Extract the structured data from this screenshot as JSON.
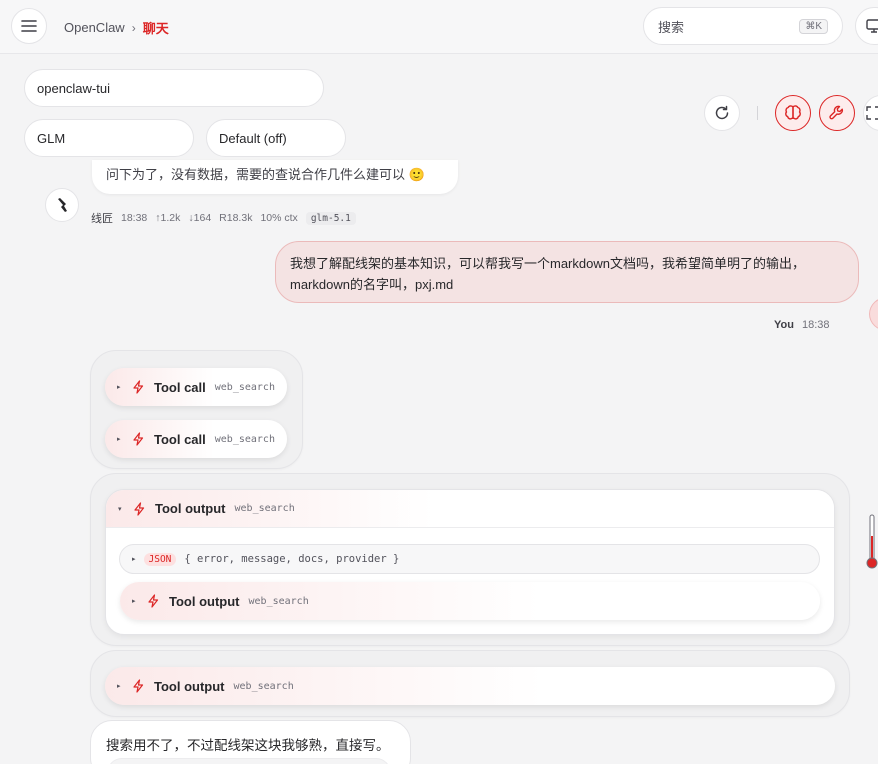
{
  "header": {
    "app_name": "OpenClaw",
    "separator": "›",
    "current_page": "聊天",
    "search_placeholder": "搜索",
    "search_shortcut": "⌘K"
  },
  "controls": {
    "session": "openclaw-tui",
    "model": "GLM",
    "thinking": "Default (off)"
  },
  "toolbar_icons": [
    "refresh-icon",
    "brain-icon",
    "wrench-icon",
    "expand-icon"
  ],
  "messages": {
    "previous_assistant_text": "问下为了，没有数据，需要的查说合作几件么建可以 🙂",
    "assistant_meta": {
      "sender": "线匠",
      "time": "18:38",
      "tokens_in": "↑1.2k",
      "tokens_out": "↓164",
      "cache": "R18.3k",
      "context": "10% ctx",
      "model": "glm-5.1"
    },
    "user_message": "我想了解配线架的基本知识，可以帮我写一个markdown文档吗，我希望简单明了的输出，markdown的名字叫，pxj.md",
    "user_meta": {
      "sender": "You",
      "time": "18:38"
    },
    "tool_calls": [
      {
        "label": "Tool call",
        "name": "web_search"
      },
      {
        "label": "Tool call",
        "name": "web_search"
      }
    ],
    "tool_output_expanded": {
      "label": "Tool output",
      "name": "web_search",
      "json_badge": "JSON",
      "json_summary": "{ error, message, docs, provider }",
      "nested": {
        "label": "Tool output",
        "name": "web_search"
      }
    },
    "tool_output_collapsed": {
      "label": "Tool output",
      "name": "web_search"
    },
    "assistant_reply": "搜索用不了，不过配线架这块我够熟，直接写。"
  },
  "colors": {
    "accent": "#dc2626",
    "user_bubble": "#f4e3e3",
    "background": "#f4f4f5"
  }
}
